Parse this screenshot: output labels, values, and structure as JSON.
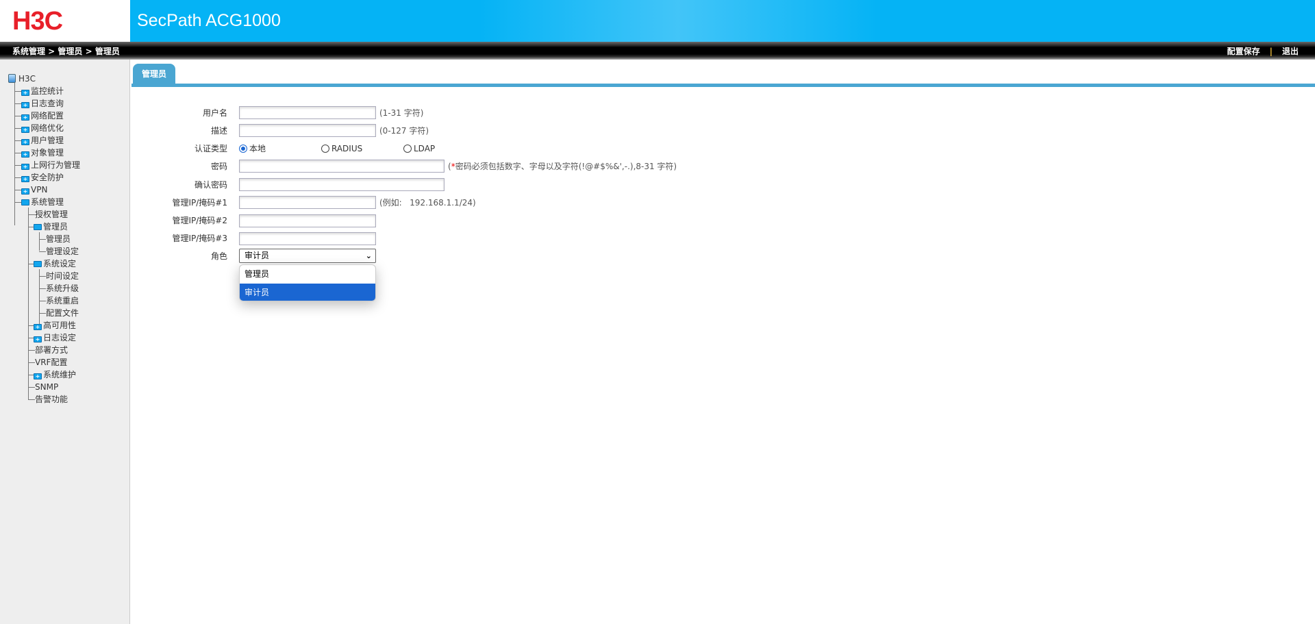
{
  "header": {
    "logo": "H3C",
    "title": "SecPath ACG1000",
    "brand_color": "#e8202a",
    "accent": "#05b3f5"
  },
  "breadcrumb": "系统管理 > 管理员 > 管理员",
  "top_links": {
    "save": "配置保存",
    "separator": "|",
    "logout": "退出"
  },
  "sidebar": {
    "root": "H3C",
    "items": [
      "监控统计",
      "日志查询",
      "网络配置",
      "网络优化",
      "用户管理",
      "对象管理",
      "上网行为管理",
      "安全防护",
      "VPN",
      "系统管理"
    ],
    "system": {
      "items": [
        "授权管理",
        "管理员",
        "系统设定",
        "高可用性",
        "日志设定",
        "部署方式",
        "VRF配置",
        "系统维护",
        "SNMP",
        "告警功能"
      ],
      "admin_children": [
        "管理员",
        "管理设定"
      ],
      "settings_children": [
        "时间设定",
        "系统升级",
        "系统重启",
        "配置文件"
      ]
    }
  },
  "tab": {
    "label": "管理员",
    "color": "#4aa6d2"
  },
  "form": {
    "username": {
      "label": "用户名",
      "value": "",
      "hint": "(1-31 字符)"
    },
    "description": {
      "label": "描述",
      "value": "",
      "hint": "(0-127 字符)"
    },
    "auth_type": {
      "label": "认证类型",
      "options": [
        "本地",
        "RADIUS",
        "LDAP"
      ],
      "selected": "本地"
    },
    "password": {
      "label": "密码",
      "value": "",
      "hint_open": "(",
      "hint_star": "*",
      "hint": "密码必须包括数字、字母以及字符(!@#$%&',-.),8-31 字符)"
    },
    "confirm_password": {
      "label": "确认密码",
      "value": ""
    },
    "ip1": {
      "label": "管理IP/掩码#1",
      "value": "",
      "hint": "(例如:   192.168.1.1/24)"
    },
    "ip2": {
      "label": "管理IP/掩码#2",
      "value": ""
    },
    "ip3": {
      "label": "管理IP/掩码#3",
      "value": ""
    },
    "role": {
      "label": "角色",
      "value": "审计员",
      "options": [
        "管理员",
        "审计员"
      ],
      "highlight": "#1a66d2"
    }
  }
}
